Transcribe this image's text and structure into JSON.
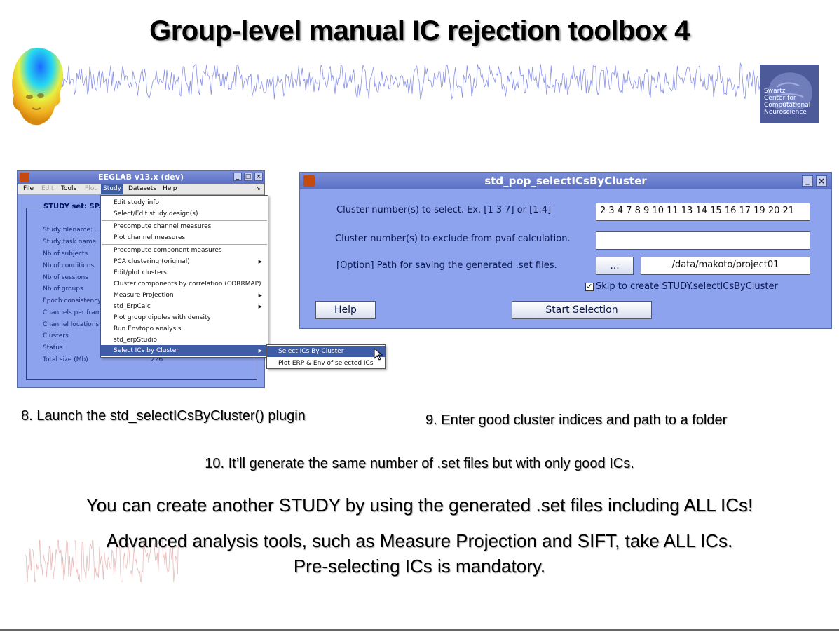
{
  "slide": {
    "title": "Group-level manual IC rejection toolbox 4",
    "logo_text": [
      "Swartz",
      "Center for",
      "Computational",
      "Neuroscience"
    ]
  },
  "eeglab_window": {
    "title": "EEGLAB v13.x (dev)",
    "menubar": [
      "File",
      "Edit",
      "Tools",
      "Plot",
      "Study",
      "Datasets",
      "Help"
    ],
    "study_set_label": "STUDY set: SP...",
    "rows": [
      {
        "label": "Study filename: ..."
      },
      {
        "label": "Study task name"
      },
      {
        "label": "Nb of subjects"
      },
      {
        "label": "Nb of conditions"
      },
      {
        "label": "Nb of sessions"
      },
      {
        "label": "Nb of groups"
      },
      {
        "label": "Epoch consistency"
      },
      {
        "label": "Channels per frame"
      },
      {
        "label": "Channel locations"
      },
      {
        "label": "Clusters"
      },
      {
        "label": "Status"
      },
      {
        "label": "Total size (Mb)",
        "value": "226"
      }
    ]
  },
  "study_menu": {
    "items": [
      "Edit study info",
      "Select/Edit study design(s)",
      "Precompute channel measures",
      "Plot channel measures",
      "Precompute component measures",
      "PCA clustering (original)",
      "Edit/plot clusters",
      "Cluster components by correlation (CORRMAP)",
      "Measure Projection",
      "std_ErpCalc",
      "Plot group dipoles with density",
      "Run Envtopo analysis",
      "std_erpStudio",
      "Select ICs by Cluster"
    ],
    "submenu": [
      "Select ICs By Cluster",
      "Plot ERP & Env of selected ICs"
    ]
  },
  "select_window": {
    "title": "std_pop_selectICsByCluster",
    "cluster_select_label": "Cluster number(s) to select. Ex. [1 3 7] or [1:4]",
    "cluster_select_value": "2 3 4 7 8 9 10 11 13 14 15 16 17 19 20 21",
    "cluster_exclude_label": "Cluster number(s) to exclude from pvaf calculation.",
    "cluster_exclude_value": "",
    "path_label": "[Option] Path for saving the generated .set files.",
    "browse_label": "...",
    "path_value": "/data/makoto/project01",
    "skip_label": "Skip to create STUDY.selectICsByCluster",
    "skip_checked": true,
    "help_label": "Help",
    "start_label": "Start Selection"
  },
  "captions": {
    "step8": "8. Launch the std_selectICsByCluster() plugin",
    "step9": "9. Enter good cluster indices and path to a folder",
    "step10": "10. It’ll generate the same number of .set files but with only good ICs.",
    "line1": "You can create another STUDY by using the generated .set files including ALL ICs!",
    "line2": "Advanced analysis tools, such as Measure Projection and SIFT, take ALL ICs.",
    "line3": "Pre-selecting ICs is mandatory."
  },
  "colors": {
    "window_bg": "#8ea3ee",
    "titlebar": "#5b70c4",
    "menu_highlight": "#3e5da6"
  }
}
